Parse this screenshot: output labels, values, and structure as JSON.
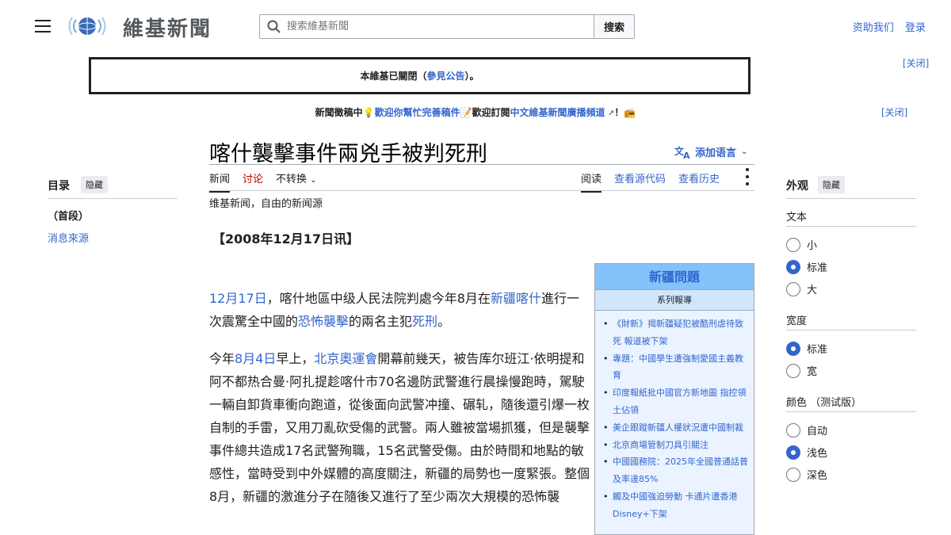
{
  "header": {
    "logo_text": "維基新聞",
    "search_placeholder": "搜索維基新聞",
    "search_button": "搜索",
    "donate_link": "资助我们",
    "login_link": "登录"
  },
  "notices": {
    "closed_prefix": "本維基已關閉（",
    "closed_link": "參見公告",
    "closed_suffix": "）。",
    "close_label": "[关闭]",
    "site_prefix": "新聞徵稿中💡",
    "site_link1": "歡迎你幫忙完善稿件",
    "site_middle": "📝歡迎訂閱",
    "site_link2": "中文維基新聞廣播頻道",
    "site_suffix": "！📻",
    "site_close_label": "[关闭]"
  },
  "page": {
    "title": "喀什襲擊事件兩兇手被判死刑",
    "add_languages": "添加语言",
    "tabs_left": [
      "新闻",
      "讨论",
      "不转换"
    ],
    "tabs_right": [
      "阅读",
      "查看源代码",
      "查看历史"
    ],
    "tagline": "维基新闻，自由的新闻源",
    "dateline": "【2008年12月17日讯】"
  },
  "article": {
    "p1": {
      "date_link": "12月17日",
      "t1": "，喀什地區中级人民法院判處今年8月在",
      "place_link": "新疆喀什",
      "t2": "進行一次震驚全中國的",
      "attack_link": "恐怖襲擊",
      "t3": "的兩名主犯",
      "death_link": "死刑",
      "t4": "。"
    },
    "p2": {
      "t0": "今年",
      "date_link": "8月4日",
      "t1": "早上，",
      "games_link": "北京奧運會",
      "t2": "開幕前幾天，被告库尔班江·依明提和阿不都热合曼·阿扎提趁喀什市70名邊防武警進行晨操慢跑時，駕駛一輛自卸貨車衝向跑道，從後面向武警冲撞、碾轧，隨後還引爆一枚自制的手雷，又用刀亂砍受傷的武警。兩人雖被當場抓獲，但是襲擊事件總共造成17名武警殉職，15名武警受傷。由於時間和地點的敏感性，當時受到中外媒體的高度關注，新疆的局勢也一度緊張。整個8月，新疆的激進分子在隨後又進行了至少兩次大規模的恐怖襲"
    }
  },
  "infobox": {
    "title": "新疆問題",
    "subtitle": "系列報導",
    "items": [
      "《財新》揭新疆疑犯被酷刑虐待致死 報道被下架",
      "專題：中國學生遭強制愛國主義教育",
      "印度報紙批中國官方新地圖 指控領土佔領",
      "美企跟蹤新疆人權狀況遭中國制裁",
      "北京商場管制刀具引關注",
      "中國國務院：2025年全國普通話普及率達85%",
      "觸及中國強迫勞動 卡通片遭香港Disney+下架"
    ]
  },
  "toc": {
    "title": "目录",
    "hide": "隐藏",
    "items": [
      "（首段）",
      "消息來源"
    ]
  },
  "appearance": {
    "title": "外观",
    "hide": "隐藏",
    "text_label": "文本",
    "text_options": [
      "小",
      "标准",
      "大"
    ],
    "width_label": "宽度",
    "width_options": [
      "标准",
      "宽"
    ],
    "color_label": "颜色 （测试版）",
    "color_options": [
      "自动",
      "浅色",
      "深色"
    ],
    "selected": {
      "text": "标准",
      "width": "标准",
      "color": "浅色"
    }
  }
}
